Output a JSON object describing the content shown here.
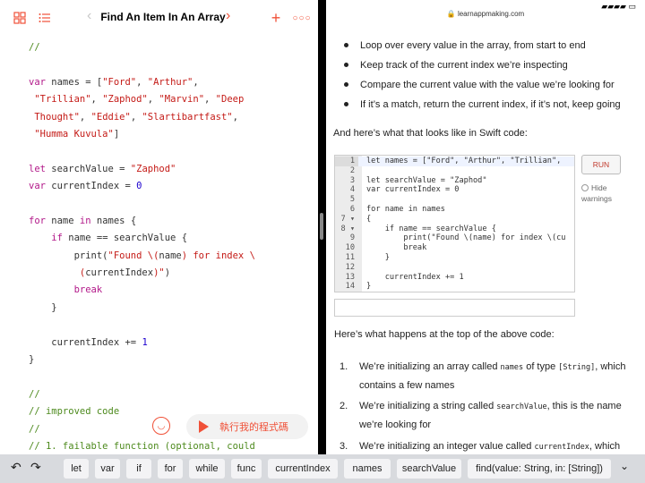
{
  "left_toolbar": {
    "title": "Find An Item In An Array"
  },
  "code_lines": [
    "//",
    "",
    "var names = [\"Ford\", \"Arthur\",",
    " \"Trillian\", \"Zaphod\", \"Marvin\", \"Deep",
    " Thought\", \"Eddie\", \"Slartibartfast\",",
    " \"Humma Kuvula\"]",
    "",
    "let searchValue = \"Zaphod\"",
    "var currentIndex = 0",
    "",
    "for name in names {",
    "    if name == searchValue {",
    "        print(\"Found \\(name) for index \\",
    "         (currentIndex)\")",
    "        break",
    "    }",
    "",
    "    currentIndex += 1",
    "}",
    "",
    "//",
    "// improved code",
    "//",
    "// 1. failable function (optional, could"
  ],
  "run_button": {
    "label": "執行我的程式碼"
  },
  "right": {
    "url": "learnappmaking.com",
    "bullets": [
      "Loop over every value in the array, from start to end",
      "Keep track of the current index we’re inspecting",
      "Compare the current value with the value we’re looking for",
      "If it’s a match, return the current index, if it’s not, keep going"
    ],
    "intro": "And here’s what that looks like in Swift code:",
    "editor_lines": [
      {
        "n": "1",
        "c": "let names = [\"Ford\", \"Arthur\", \"Trillian\","
      },
      {
        "n": "2",
        "c": ""
      },
      {
        "n": "3",
        "c": "let searchValue = \"Zaphod\""
      },
      {
        "n": "4",
        "c": "var currentIndex = 0"
      },
      {
        "n": "5",
        "c": ""
      },
      {
        "n": "6",
        "c": "for name in names"
      },
      {
        "n": "7 ▾",
        "c": "{"
      },
      {
        "n": "8 ▾",
        "c": "    if name == searchValue {"
      },
      {
        "n": "9",
        "c": "        print(\"Found \\(name) for index \\(cu"
      },
      {
        "n": "10",
        "c": "        break"
      },
      {
        "n": "11",
        "c": "    }"
      },
      {
        "n": "12",
        "c": ""
      },
      {
        "n": "13",
        "c": "    currentIndex += 1"
      },
      {
        "n": "14",
        "c": "}"
      }
    ],
    "run_label": "RUN",
    "hide_warnings": "Hide warnings",
    "p2": "Here’s what happens at the top of the above code:",
    "list": [
      {
        "n": "1.",
        "pre": "We’re initializing an array called ",
        "code": "names",
        "mid": " of type ",
        "code2": "[String]",
        "post": ", which contains a few names"
      },
      {
        "n": "2.",
        "pre": "We’re initializing a string called ",
        "code": "searchValue",
        "mid": ", this is the name we’re looking for",
        "code2": "",
        "post": ""
      },
      {
        "n": "3.",
        "pre": "We’re initializing an integer value called ",
        "code": "currentIndex",
        "mid": ", which",
        "code2": "",
        "post": ""
      }
    ]
  },
  "shortcuts": [
    "let",
    "var",
    "if",
    "for",
    "while",
    "func",
    "currentIndex",
    "names",
    "searchValue",
    "find(value: String, in: [String])"
  ]
}
